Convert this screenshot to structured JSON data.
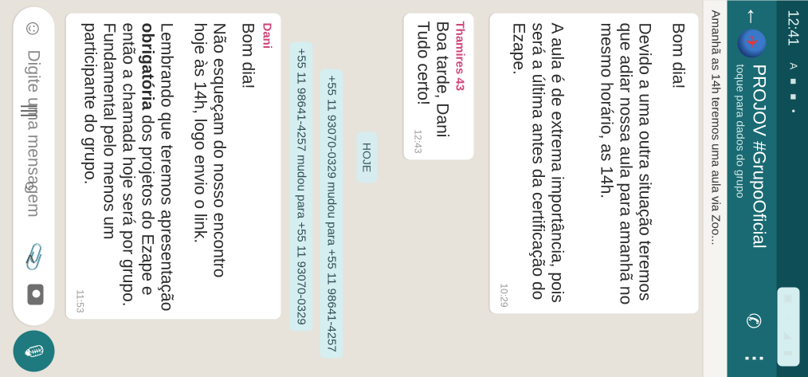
{
  "status_bar": {
    "time": "12:41",
    "notifications": "A ■ ■ •",
    "system": "▣ ◌ ◢ ▮"
  },
  "header": {
    "back_icon": "arrow-left",
    "title": "PROJOV #GrupoOficial",
    "subtitle": "toque para dados do grupo",
    "call_icon": "add-call",
    "more_icon": "more-vertical"
  },
  "pinned": {
    "text": "Amanhã as 14h teremos uma aula via Zoo..."
  },
  "messages": [
    {
      "greeting": "Bom dia!",
      "p1": "Devido a uma outra situação teremos que adiar nossa aula para amanhã no mesmo horário, as 14h.",
      "p2": "A aula é de extrema importância, pois será a última antes da certificação do Ezape.",
      "time": "10:29"
    },
    {
      "sender": "Thamires 43",
      "line1": "Boa tarde, Dani",
      "line2": "Tudo certo!",
      "time": "12:43"
    },
    {
      "sender": "Dani",
      "greeting": "Bom dia!",
      "p1": "Não esqueçam do nosso encontro hoje às 14h, logo envio o link.",
      "p2_pre": "Lembrando que teremos apresentação ",
      "p2_bold": "obrigatória",
      "p2_post": " dos projetos do Ezape e então a chamada hoje será por grupo. Fundamental pelo menos um participante do grupo.",
      "time": "11:53"
    }
  ],
  "date_chip": "HOJE",
  "system_messages": [
    "+55 11 93070-0329 mudou para +55 11 98641-4257",
    "+55 11 98641-4257 mudou para +55 11 93070-0329"
  ],
  "composer": {
    "placeholder": "Digite uma mensagem"
  },
  "nav": {
    "recents": "|||",
    "home": "○",
    "back": "<"
  }
}
